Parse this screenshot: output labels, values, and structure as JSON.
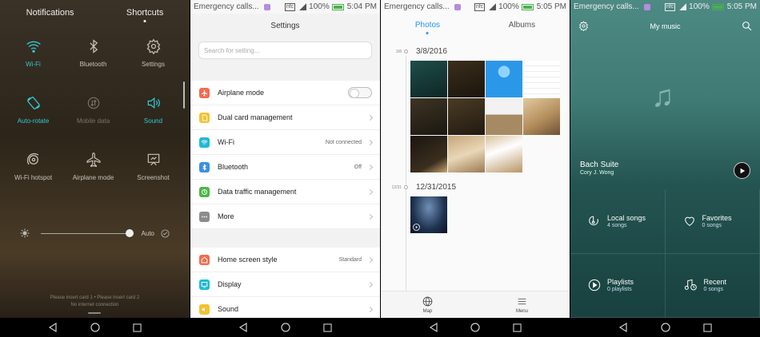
{
  "notification_shade": {
    "tabs": [
      {
        "label": "Notifications"
      },
      {
        "label": "Shortcuts"
      }
    ],
    "toggles": [
      {
        "label": "Wi-Fi",
        "icon": "wifi-icon",
        "state": "on"
      },
      {
        "label": "Bluetooth",
        "icon": "bluetooth-icon",
        "state": "off"
      },
      {
        "label": "Settings",
        "icon": "gear-icon",
        "state": "off"
      },
      {
        "label": "Auto-rotate",
        "icon": "auto-rotate-icon",
        "state": "on"
      },
      {
        "label": "Mobile data",
        "icon": "mobile-data-icon",
        "state": "disabled"
      },
      {
        "label": "Sound",
        "icon": "speaker-icon",
        "state": "on"
      },
      {
        "label": "Wi-Fi hotspot",
        "icon": "hotspot-icon",
        "state": "off"
      },
      {
        "label": "Airplane mode",
        "icon": "airplane-icon",
        "state": "off"
      },
      {
        "label": "Screenshot",
        "icon": "screenshot-icon",
        "state": "off"
      }
    ],
    "brightness": {
      "label": "Auto",
      "level": 0.94
    },
    "sim_note_line1": "Please insert card 1 • Please insert card 2",
    "sim_note_line2": "No internet connection",
    "accent": "#33c7d6"
  },
  "settings": {
    "status": {
      "carrier": "Emergency calls...",
      "battery": "100%",
      "time": "5:04 PM"
    },
    "title": "Settings",
    "search_placeholder": "Search for setting...",
    "group1": [
      {
        "label": "Airplane mode",
        "icon": "airplane-icon",
        "color": "#f36b4f",
        "control": "toggle",
        "value": ""
      },
      {
        "label": "Dual card management",
        "icon": "sim-card-icon",
        "color": "#f5c131",
        "control": "chevron",
        "value": ""
      },
      {
        "label": "Wi-Fi",
        "icon": "wifi-icon",
        "color": "#1fb9d5",
        "control": "chevron",
        "value": "Not connected"
      },
      {
        "label": "Bluetooth",
        "icon": "bluetooth-icon",
        "color": "#3d8fe0",
        "control": "chevron",
        "value": "Off"
      },
      {
        "label": "Data traffic management",
        "icon": "data-traffic-icon",
        "color": "#49b848",
        "control": "chevron",
        "value": ""
      },
      {
        "label": "More",
        "icon": "more-icon",
        "color": "#8c8c8c",
        "control": "chevron",
        "value": ""
      }
    ],
    "group2": [
      {
        "label": "Home screen style",
        "icon": "home-icon",
        "color": "#f36b4f",
        "control": "chevron",
        "value": "Standard"
      },
      {
        "label": "Display",
        "icon": "display-icon",
        "color": "#1fb9d5",
        "control": "chevron",
        "value": ""
      },
      {
        "label": "Sound",
        "icon": "sound-icon",
        "color": "#f5c131",
        "control": "chevron",
        "value": ""
      }
    ]
  },
  "gallery": {
    "status": {
      "carrier": "Emergency calls...",
      "battery": "100%",
      "time": "5:05 PM"
    },
    "tabs": [
      {
        "label": "Photos"
      },
      {
        "label": "Albums"
      }
    ],
    "sections": [
      {
        "short": "3/8",
        "date": "3/8/2016",
        "count": 11
      },
      {
        "short": "12/31",
        "date": "12/31/2015",
        "count": 1
      }
    ],
    "bottom": [
      {
        "label": "Map",
        "icon": "globe-icon"
      },
      {
        "label": "Menu",
        "icon": "menu-icon"
      }
    ],
    "accent": "#2196f3"
  },
  "music": {
    "status": {
      "carrier": "Emergency calls...",
      "battery": "100%",
      "time": "5:05 PM"
    },
    "title": "My music",
    "track_title": "Bach Suite",
    "track_artist": "Cory J. Wong",
    "cells": [
      {
        "title": "Local songs",
        "sub": "4 songs",
        "icon": "local-songs-icon"
      },
      {
        "title": "Favorites",
        "sub": "0 songs",
        "icon": "heart-icon"
      },
      {
        "title": "Playlists",
        "sub": "0 playlists",
        "icon": "playlist-icon"
      },
      {
        "title": "Recent",
        "sub": "0 songs",
        "icon": "recent-icon"
      }
    ]
  }
}
